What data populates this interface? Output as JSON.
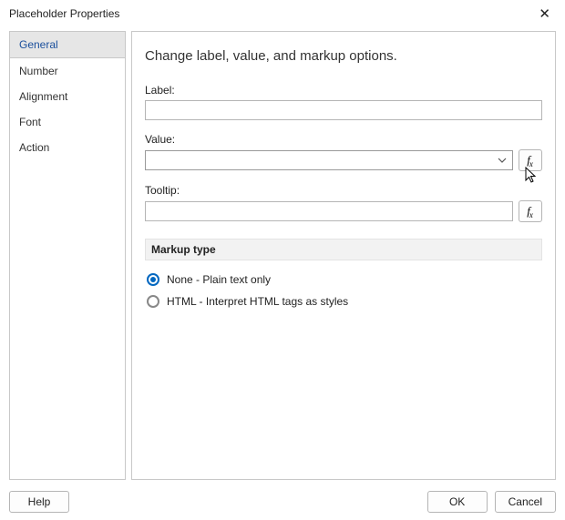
{
  "window": {
    "title": "Placeholder Properties"
  },
  "sidebar": {
    "items": [
      {
        "label": "General",
        "active": true
      },
      {
        "label": "Number"
      },
      {
        "label": "Alignment"
      },
      {
        "label": "Font"
      },
      {
        "label": "Action"
      }
    ]
  },
  "panel": {
    "title": "Change label, value, and markup options.",
    "fields": {
      "label": {
        "caption": "Label:",
        "value": ""
      },
      "value": {
        "caption": "Value:",
        "selected": ""
      },
      "tooltip": {
        "caption": "Tooltip:",
        "value": ""
      }
    },
    "markup": {
      "header": "Markup type",
      "options": [
        {
          "label": "None - Plain text only",
          "checked": true
        },
        {
          "label": "HTML - Interpret HTML tags as styles",
          "checked": false
        }
      ]
    }
  },
  "footer": {
    "help": "Help",
    "ok": "OK",
    "cancel": "Cancel"
  }
}
